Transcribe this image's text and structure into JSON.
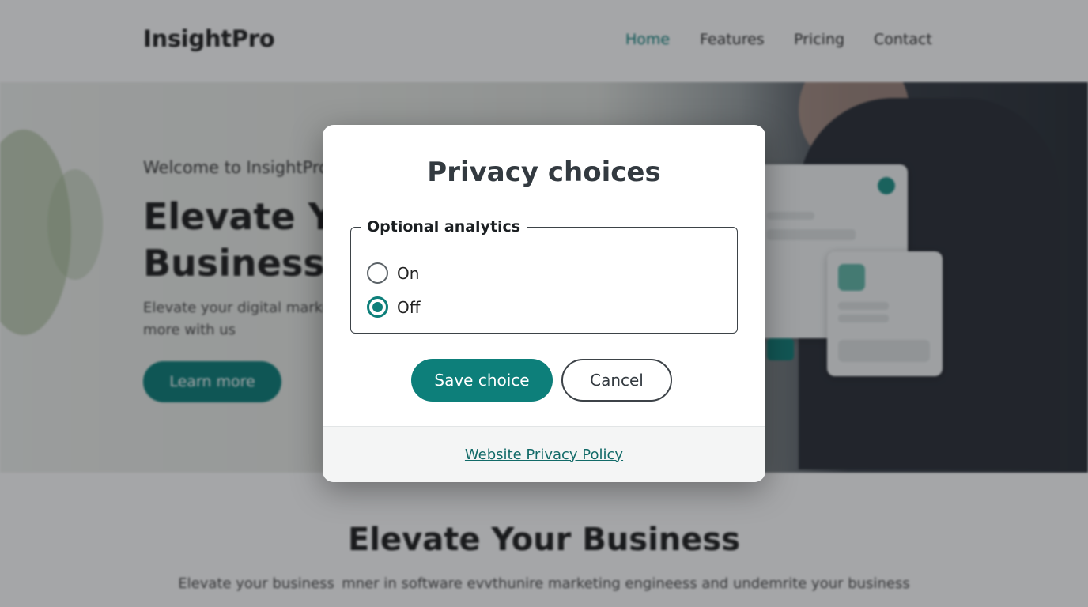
{
  "site": {
    "brand": "InsightPro",
    "nav": [
      {
        "label": "Home",
        "active": true
      },
      {
        "label": "Features",
        "active": false
      },
      {
        "label": "Pricing",
        "active": false
      },
      {
        "label": "Contact",
        "active": false
      }
    ],
    "hero": {
      "welcome": "Welcome to InsightPro",
      "title": "Elevate Your Business",
      "description": "Elevate your digital marketing business and grow more with us",
      "cta": "Learn more"
    },
    "section": {
      "title": "Elevate Your Business",
      "description": "Elevate your business  mner in software evvthunire marketing engineess and undemrite your business"
    }
  },
  "modal": {
    "title": "Privacy choices",
    "group_legend": "Optional analytics",
    "options": [
      {
        "label": "On",
        "checked": false
      },
      {
        "label": "Off",
        "checked": true
      }
    ],
    "save_label": "Save choice",
    "cancel_label": "Cancel",
    "policy_link": "Website Privacy Policy"
  },
  "colors": {
    "accent": "#0d7f7a",
    "overlay": "rgba(18,22,26,0.38)"
  }
}
